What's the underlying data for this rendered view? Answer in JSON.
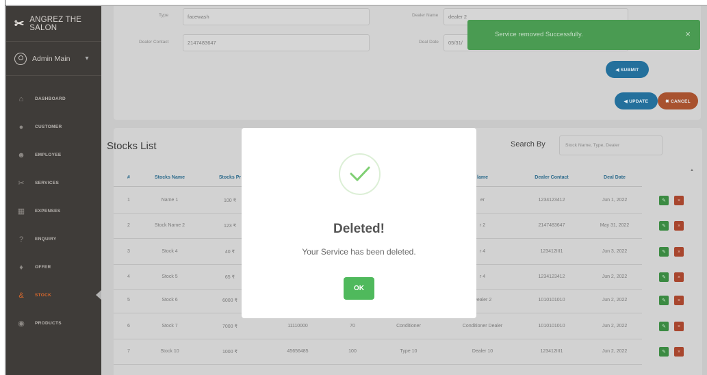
{
  "app": {
    "brand": "ANGREZ THE SALON",
    "brand_icon": "scissors-icon",
    "user": "Admin Main"
  },
  "nav": [
    {
      "label": "DASHBOARD",
      "icon": "bank-icon"
    },
    {
      "label": "CUSTOMER",
      "icon": "user-icon"
    },
    {
      "label": "EMPLOYEE",
      "icon": "users-icon"
    },
    {
      "label": "SERVICES",
      "icon": "scissors-icon"
    },
    {
      "label": "EXPENSES",
      "icon": "calculator-icon"
    },
    {
      "label": "ENQUIRY",
      "icon": "question-icon"
    },
    {
      "label": "OFFER",
      "icon": "gift-icon"
    },
    {
      "label": "STOCK",
      "icon": "stock-icon",
      "active": true
    },
    {
      "label": "PRODUCTS",
      "icon": "product-icon"
    }
  ],
  "form": {
    "type_label": "Type",
    "type_value": "facewash",
    "dealer_contact_label": "Dealer Contact",
    "dealer_contact_value": "2147483647",
    "dealer_name_label": "Dealer Name",
    "dealer_name_value": "dealer 2",
    "deal_date_label": "Deal Date",
    "deal_date_value": "05/31/",
    "submit": "◀ SUBMIT",
    "update": "◀ UPDATE",
    "cancel": "✖ CANCEL"
  },
  "toast": {
    "message": "Service removed Successfully.",
    "close": "×"
  },
  "list": {
    "title": "Stocks List",
    "search_label": "Search By",
    "search_placeholder": "Stock Name, Type, Dealer",
    "headers": [
      "#",
      "Stocks Name",
      "Stocks Pr",
      "lame",
      "Dealer Contact",
      "Deal Date"
    ],
    "rows": [
      {
        "n": "1",
        "name": "Name 1",
        "price": "100 ₹",
        "qty": "",
        "count": "",
        "type": "",
        "dealer": "er",
        "contact": "1234123412",
        "date": "Jun 1, 2022"
      },
      {
        "n": "2",
        "name": "Stock Name 2",
        "price": "123 ₹",
        "qty": "",
        "count": "",
        "type": "",
        "dealer": "r 2",
        "contact": "2147483647",
        "date": "May 31, 2022"
      },
      {
        "n": "3",
        "name": "Stock 4",
        "price": "40 ₹",
        "qty": "",
        "count": "",
        "type": "",
        "dealer": "r 4",
        "contact": "123412III1",
        "date": "Jun 3, 2022"
      },
      {
        "n": "4",
        "name": "Stock 5",
        "price": "65 ₹",
        "qty": "",
        "count": "",
        "type": "",
        "dealer": "r 4",
        "contact": "1234123412",
        "date": "Jun 2, 2022"
      },
      {
        "n": "5",
        "name": "Stock 6",
        "price": "6000 ₹",
        "qty": "",
        "count": "",
        "type": "",
        "dealer": "Dealer 2",
        "contact": "1010101010",
        "date": "Jun 2, 2022"
      },
      {
        "n": "6",
        "name": "Stock 7",
        "price": "7000 ₹",
        "qty": "11110000",
        "count": "70",
        "type": "Conditioner",
        "dealer": "Conditioner Dealer",
        "contact": "1010101010",
        "date": "Jun 2, 2022"
      },
      {
        "n": "7",
        "name": "Stock 10",
        "price": "1000 ₹",
        "qty": "45656485",
        "count": "100",
        "type": "Type 10",
        "dealer": "Dealer 10",
        "contact": "123412III1",
        "date": "Jun 2, 2022"
      }
    ]
  },
  "modal": {
    "title": "Deleted!",
    "text": "Your Service has been deleted.",
    "ok": "OK"
  },
  "colors": {
    "accent": "#24709c",
    "cancel": "#a8522f",
    "success": "#4fb95c",
    "sidebar": "#3f3c39",
    "active": "#d8682c"
  }
}
